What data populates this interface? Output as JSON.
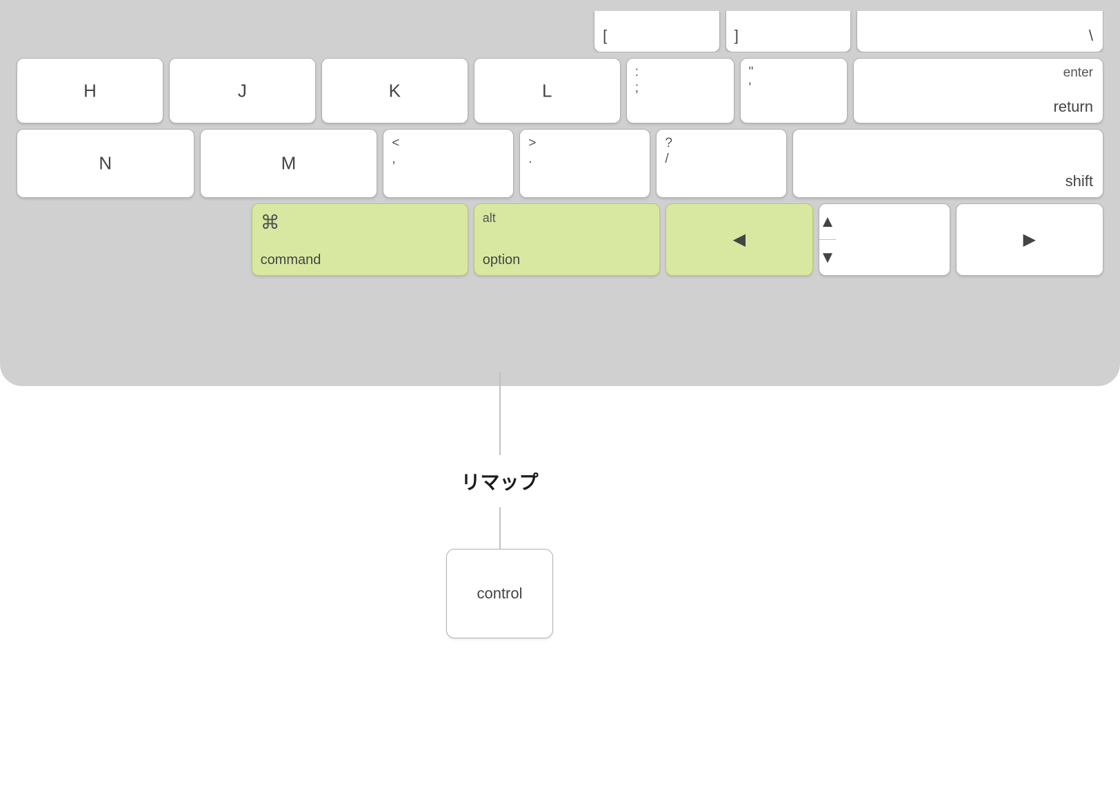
{
  "keyboard": {
    "background_color": "#d0d0d0",
    "key_color": "#ffffff",
    "highlighted_color": "#d9e8a0",
    "rows": {
      "row0_partial": {
        "keys": [
          {
            "id": "bracket_left",
            "top": "[",
            "bottom": ""
          },
          {
            "id": "bracket_right",
            "top": "]",
            "bottom": ""
          },
          {
            "id": "backslash",
            "top": "\\",
            "bottom": ""
          }
        ]
      },
      "row1": {
        "keys": [
          {
            "id": "h",
            "label": "H"
          },
          {
            "id": "j",
            "label": "J"
          },
          {
            "id": "k",
            "label": "K"
          },
          {
            "id": "l",
            "label": "L"
          },
          {
            "id": "semicolon",
            "top": ":",
            "bottom": ";"
          },
          {
            "id": "quote",
            "top": "\"",
            "bottom": "'"
          },
          {
            "id": "enter",
            "top": "enter",
            "bottom": "return"
          }
        ]
      },
      "row2": {
        "keys": [
          {
            "id": "n",
            "label": "N"
          },
          {
            "id": "m",
            "label": "M"
          },
          {
            "id": "comma_key",
            "top": "<",
            "bottom": ","
          },
          {
            "id": "period_key",
            "top": ">",
            "bottom": "."
          },
          {
            "id": "slash_key",
            "top": "?",
            "bottom": "/"
          },
          {
            "id": "shift_right",
            "label": "shift"
          }
        ]
      },
      "row3": {
        "keys": [
          {
            "id": "fn",
            "label": ""
          },
          {
            "id": "ctrl_left",
            "label": ""
          },
          {
            "id": "command",
            "symbol": "⌘",
            "label": "command",
            "highlighted": true
          },
          {
            "id": "option",
            "top": "alt",
            "label": "option",
            "highlighted": true
          },
          {
            "id": "left_arrow",
            "symbol": "◀",
            "highlighted": true
          },
          {
            "id": "up_arrow",
            "symbol": "▲"
          },
          {
            "id": "down_arrow",
            "symbol": "▼"
          },
          {
            "id": "right_arrow",
            "symbol": "▶"
          }
        ]
      }
    }
  },
  "connector": {
    "line_color": "#c0c0c0",
    "remap_label": "リマップ",
    "target_key": {
      "label": "control"
    }
  }
}
